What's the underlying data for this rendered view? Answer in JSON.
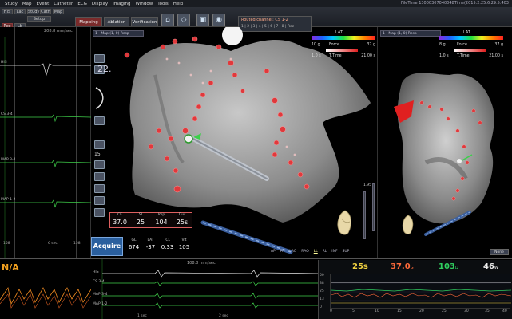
{
  "window": {
    "menu": [
      "Study",
      "Map",
      "Event",
      "Catheter",
      "ECG",
      "Display",
      "Imaging",
      "Window",
      "Tools",
      "Help"
    ],
    "file_time": "FileTime 13000307040048Time(2015.2.25.6.29.5.403"
  },
  "toolbar": {
    "small_buttons": [
      "HIS",
      "Lac",
      "Study",
      "Cath",
      "Map",
      "Setup",
      "Rec",
      "Lb"
    ],
    "tabs": [
      "Mapping",
      "Ablation",
      "Verification"
    ],
    "routed_label": "Routed channel: CS 1-2",
    "routed_sub": "1 | 2 | 3 | 4 | 5 | 6 | 7 | 8 | Rec"
  },
  "ecg_left": {
    "speed": "208.8 mm/sec",
    "channels": [
      "HIS",
      "CS 3-4",
      "MAP 3-4",
      "MAP 1-2"
    ],
    "scale_left": "158",
    "scale_mid": "6 sec",
    "scale_right": "158"
  },
  "tools": {
    "zoom": "22.",
    "rotate_value": "15"
  },
  "main_map": {
    "selector": "1 - Map (1, 0) Resp",
    "lat_title": "LAT",
    "force_value": "10 g",
    "force_label": "Force",
    "force_max": "37 g",
    "time_value": "1.0 s",
    "time_label": "T.Time",
    "time_max": "21.00 s",
    "ruler_top": "1.95",
    "ruler_mid": "4.75",
    "view_buttons": [
      "AP",
      "PA",
      "LAO",
      "RAO",
      "LL",
      "RL",
      "INF",
      "SUP"
    ],
    "selected_view": "LL"
  },
  "right_map": {
    "selector": "1 - Map (1, 0) Resp",
    "lat_title": "LAT",
    "force_value": "8 g",
    "force_label": "Force",
    "force_max": "37 g",
    "time_value": "1.0 s",
    "time_label": "T.Time",
    "time_max": "21.00 s",
    "none_label": "None"
  },
  "acquire": {
    "headers": [
      "CF",
      "SI",
      "Imp",
      "Dur"
    ],
    "values": [
      "37.0",
      "25",
      "104",
      "25s"
    ],
    "headers2": [
      "GL",
      "LAT",
      "ICL",
      "Vlt"
    ],
    "values2": [
      "674",
      "-37",
      "0.33",
      "105"
    ],
    "button": "Acquire"
  },
  "bottom": {
    "na_label": "N/A",
    "ecg_speed": "108.8 mm/sec",
    "channels": [
      "HIS",
      "CS 3-4",
      "MAP 3-4",
      "MAP 1-2"
    ],
    "ticks": [
      "1 sec",
      "2 sec"
    ]
  },
  "stats": {
    "duration": "25s",
    "cf": "37.0",
    "cf_unit": "G",
    "imp": "103",
    "imp_unit": "Ω",
    "power": "46",
    "power_unit": "W",
    "y_labels": [
      "50",
      "38",
      "25",
      "13",
      "0"
    ],
    "x_labels": [
      "0",
      "5",
      "10",
      "15",
      "20",
      "25",
      "30",
      "35",
      "40"
    ],
    "colors": {
      "duration": "#f0d040",
      "cf": "#ff6a3a",
      "imp": "#30d060",
      "power": "#f0f0f0"
    }
  }
}
